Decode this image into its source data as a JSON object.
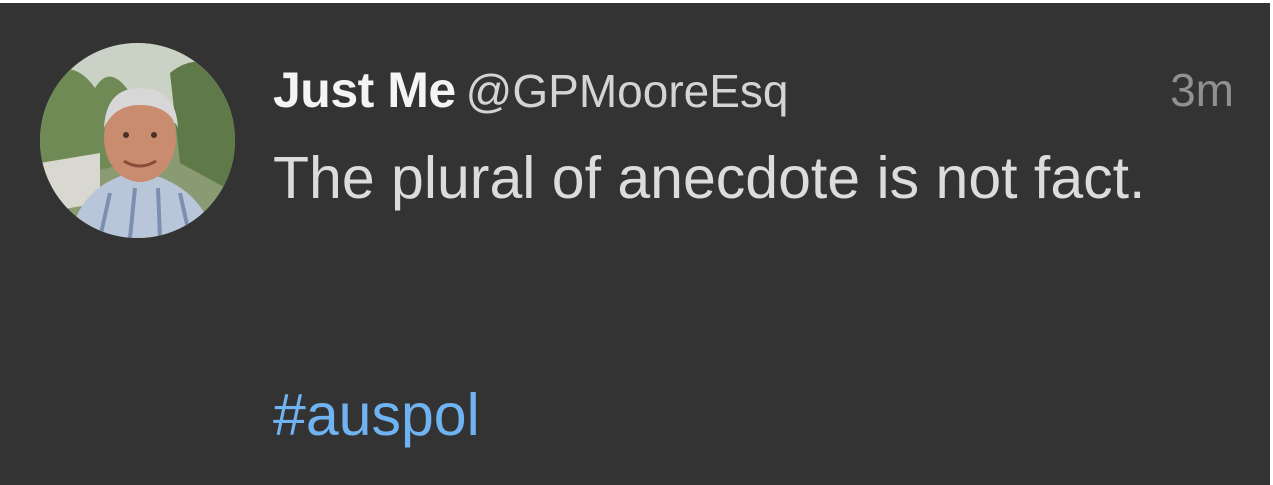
{
  "tweet": {
    "display_name": "Just Me",
    "handle": "@GPMooreEsq",
    "timestamp": "3m",
    "text": "The plural of anecdote is not fact.",
    "hashtag": "#auspol",
    "avatar_icon": "user-avatar-photo"
  },
  "colors": {
    "background": "#333333",
    "name": "#f4f4f4",
    "handle": "#d4d4d4",
    "timestamp": "#909090",
    "body": "#dcdcdc",
    "hashtag": "#6fb3f2"
  }
}
